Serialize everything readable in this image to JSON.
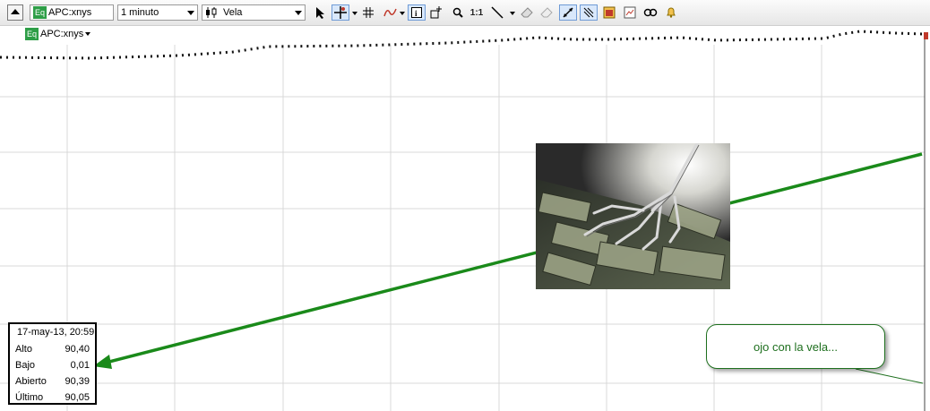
{
  "toolbar": {
    "symbol": "APC:xnys",
    "symbol_badge": "Eq",
    "interval": "1 minuto",
    "chart_style": "Vela",
    "zoom_reset_label": "1:1"
  },
  "chart": {
    "symbol_label": "APC:xnys",
    "symbol_badge": "Eq"
  },
  "data_window": {
    "timestamp": "17-may-13, 20:59",
    "rows": [
      {
        "label": "Alto",
        "value": "90,40"
      },
      {
        "label": "Bajo",
        "value": "0,01"
      },
      {
        "label": "Abierto",
        "value": "90,39"
      },
      {
        "label": "Último",
        "value": "90,05"
      }
    ]
  },
  "annotation": {
    "text": "ojo con la vela..."
  },
  "colors": {
    "arrow": "#1a8a1a",
    "price_line": "#111111",
    "grid": "#d8d8d8",
    "badge": "#2e9e47"
  },
  "icons": [
    "collapse-icon",
    "pointer-icon",
    "crosshair-icon",
    "grid-icon",
    "indicator-icon",
    "info-icon",
    "add-window-icon",
    "zoom-icon",
    "line-tool-icon",
    "eraser-icon",
    "auto-scale-icon",
    "link-icon",
    "alert-bell-icon"
  ]
}
